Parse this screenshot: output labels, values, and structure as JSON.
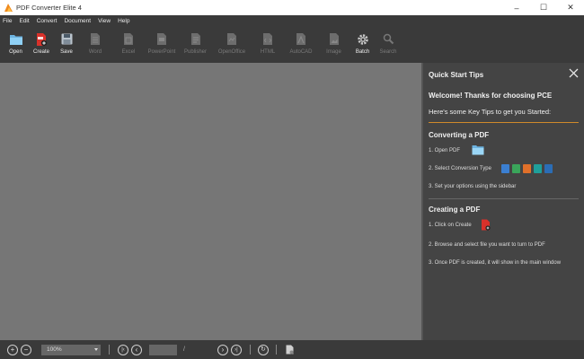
{
  "window": {
    "title": "PDF Converter Elite 4",
    "controls": [
      "–",
      "☐",
      "✕"
    ]
  },
  "menu": [
    "File",
    "Edit",
    "Convert",
    "Document",
    "View",
    "Help"
  ],
  "toolbar": {
    "open": "Open",
    "create": "Create",
    "save": "Save",
    "word": "Word",
    "excel": "Excel",
    "powerpoint": "PowerPoint",
    "publisher": "Publisher",
    "openoffice": "OpenOffice",
    "html": "HTML",
    "autocad": "AutoCAD",
    "image": "Image",
    "batch": "Batch",
    "search": "Search"
  },
  "sidebar": {
    "title": "Quick Start Tips",
    "welcome": "Welcome! Thanks for choosing PCE",
    "subtitle": "Here's some Key Tips to get you Started:",
    "converting": {
      "heading": "Converting a PDF",
      "step1": "1. Open PDF",
      "step2": "2. Select Conversion Type",
      "step3": "3. Set your options using the sidebar"
    },
    "creating": {
      "heading": "Creating a PDF",
      "step1": "1. Click on Create",
      "step2": "2. Browse and select file you want to turn to PDF",
      "step3": "3. Once PDF is created, it will show in the main window"
    }
  },
  "statusbar": {
    "zoom": "100%",
    "page_value": "",
    "page_sep": "/"
  },
  "colors": {
    "chrome": "#3a3a3a",
    "canvas": "#767676",
    "sidebar": "#444444",
    "accent_orange": "#d08a2a",
    "folder_blue": "#7fbfe6"
  }
}
